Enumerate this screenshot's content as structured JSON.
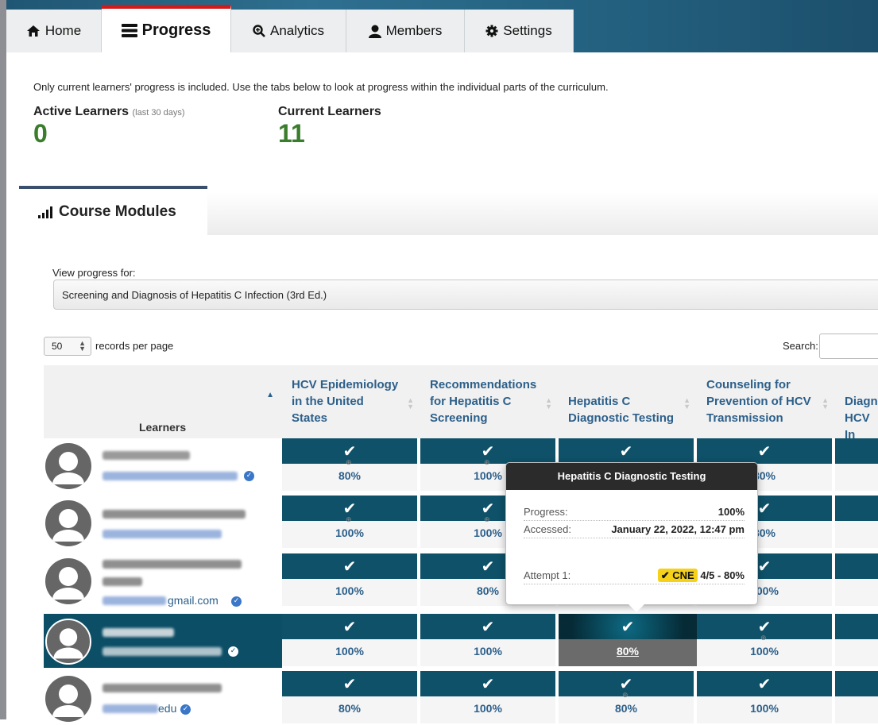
{
  "nav": {
    "tabs": [
      {
        "label": "Home",
        "icon": "home-icon"
      },
      {
        "label": "Progress",
        "icon": "progress-icon",
        "active": true
      },
      {
        "label": "Analytics",
        "icon": "magnifier-icon"
      },
      {
        "label": "Members",
        "icon": "user-icon"
      },
      {
        "label": "Settings",
        "icon": "gear-icon"
      }
    ]
  },
  "intro_text": "Only current learners' progress is included. Use the tabs below to look at progress within the individual parts of the curriculum.",
  "stats": {
    "active_label": "Active Learners",
    "active_sub": "(last 30 days)",
    "active_value": "0",
    "current_label": "Current Learners",
    "current_value": "11"
  },
  "modules_tab": "Course Modules",
  "view_progress": {
    "label": "View progress for:",
    "selected": "Screening and Diagnosis of Hepatitis C Infection (3rd Ed.)"
  },
  "table_controls": {
    "records_value": "50",
    "records_label": "records per page",
    "search_label": "Search:"
  },
  "columns": {
    "learners": "Learners",
    "c1": [
      "HCV Epidemiology",
      "in the United",
      "States"
    ],
    "c2": [
      "Recommendations",
      "for Hepatitis C",
      "Screening"
    ],
    "c3": [
      "Hepatitis C",
      "Diagnostic Testing"
    ],
    "c4": [
      "Counseling for",
      "Prevention of HCV",
      "Transmission"
    ],
    "c5": [
      "Diagn",
      "HCV In"
    ]
  },
  "rows": [
    {
      "email_tail": "",
      "values": [
        "80%",
        "100%",
        "",
        "80%"
      ]
    },
    {
      "email_tail": "",
      "values": [
        "100%",
        "100%",
        "",
        "80%"
      ]
    },
    {
      "email_tail": "gmail.com",
      "values": [
        "100%",
        "80%",
        "",
        "100%"
      ]
    },
    {
      "email_tail": "",
      "values": [
        "100%",
        "100%",
        "80%",
        "100%"
      ]
    },
    {
      "email_tail": "edu",
      "values": [
        "80%",
        "100%",
        "80%",
        "100%"
      ]
    }
  ],
  "check_glyph": "✔",
  "popover": {
    "title": "Hepatitis C Diagnostic Testing",
    "progress_label": "Progress:",
    "progress_value": "100%",
    "accessed_label": "Accessed:",
    "accessed_value": "January 22, 2022, 12:47 pm",
    "attempt_label": "Attempt 1:",
    "badge": "CNE",
    "attempt_value": "4/5 - 80%"
  },
  "colors": {
    "accent_red": "#d11a1a",
    "teal": "#0e5169",
    "green_stat": "#3a7d2c",
    "link_blue": "#2c5f8a"
  }
}
